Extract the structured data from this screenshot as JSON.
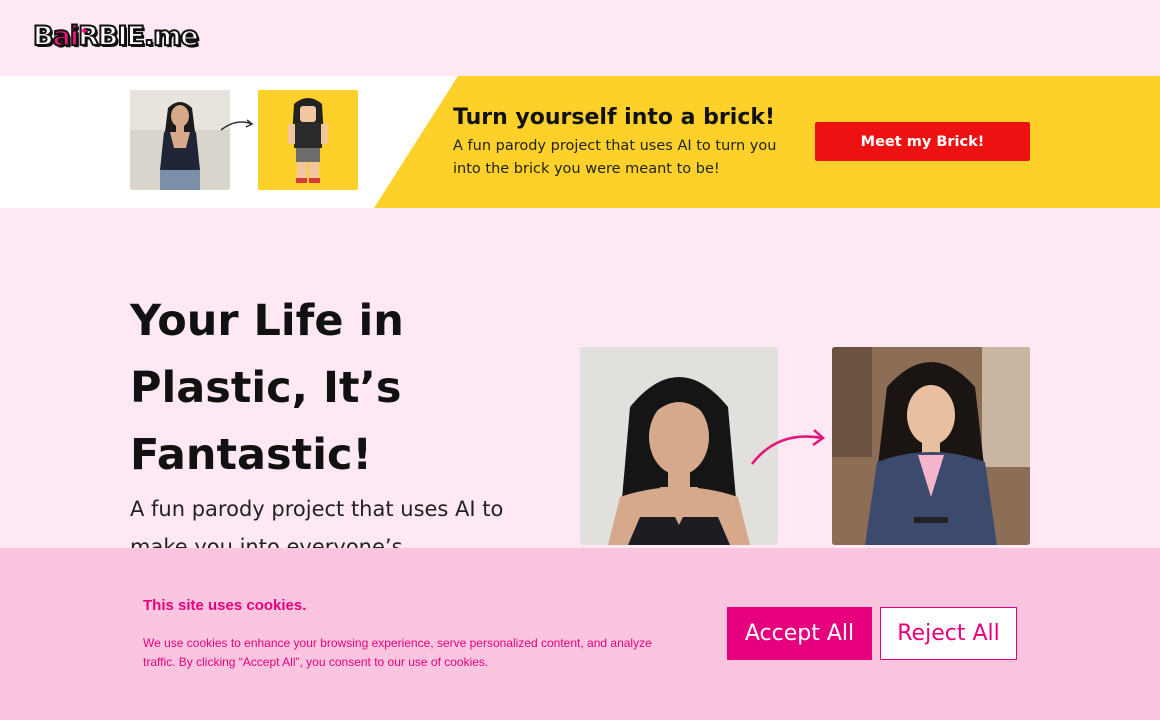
{
  "header": {
    "logo_parts": {
      "b": "B",
      "ai": "ai",
      "rest": "RBIE.me"
    }
  },
  "banner": {
    "title": "Turn yourself into a brick!",
    "description": "A fun parody project that uses AI to turn you into the brick you were meant to be!",
    "button_label": "Meet my Brick!",
    "colors": {
      "yellow": "#fdd12a",
      "button": "#ee1111"
    }
  },
  "hero": {
    "title": "Your Life in Plastic, It’s Fantastic!",
    "description": "A fun parody project that uses AI to make you into everyone’s"
  },
  "cookie": {
    "title": "This site uses cookies.",
    "text": "We use cookies to enhance your browsing experience, serve personalized content, and analyze traffic. By clicking “Accept All”, you consent to our use of cookies.",
    "accept_label": "Accept All",
    "reject_label": "Reject All",
    "colors": {
      "accent": "#e6007e",
      "background": "#fbc4df"
    }
  },
  "colors": {
    "page_background": "#fde8f4"
  }
}
